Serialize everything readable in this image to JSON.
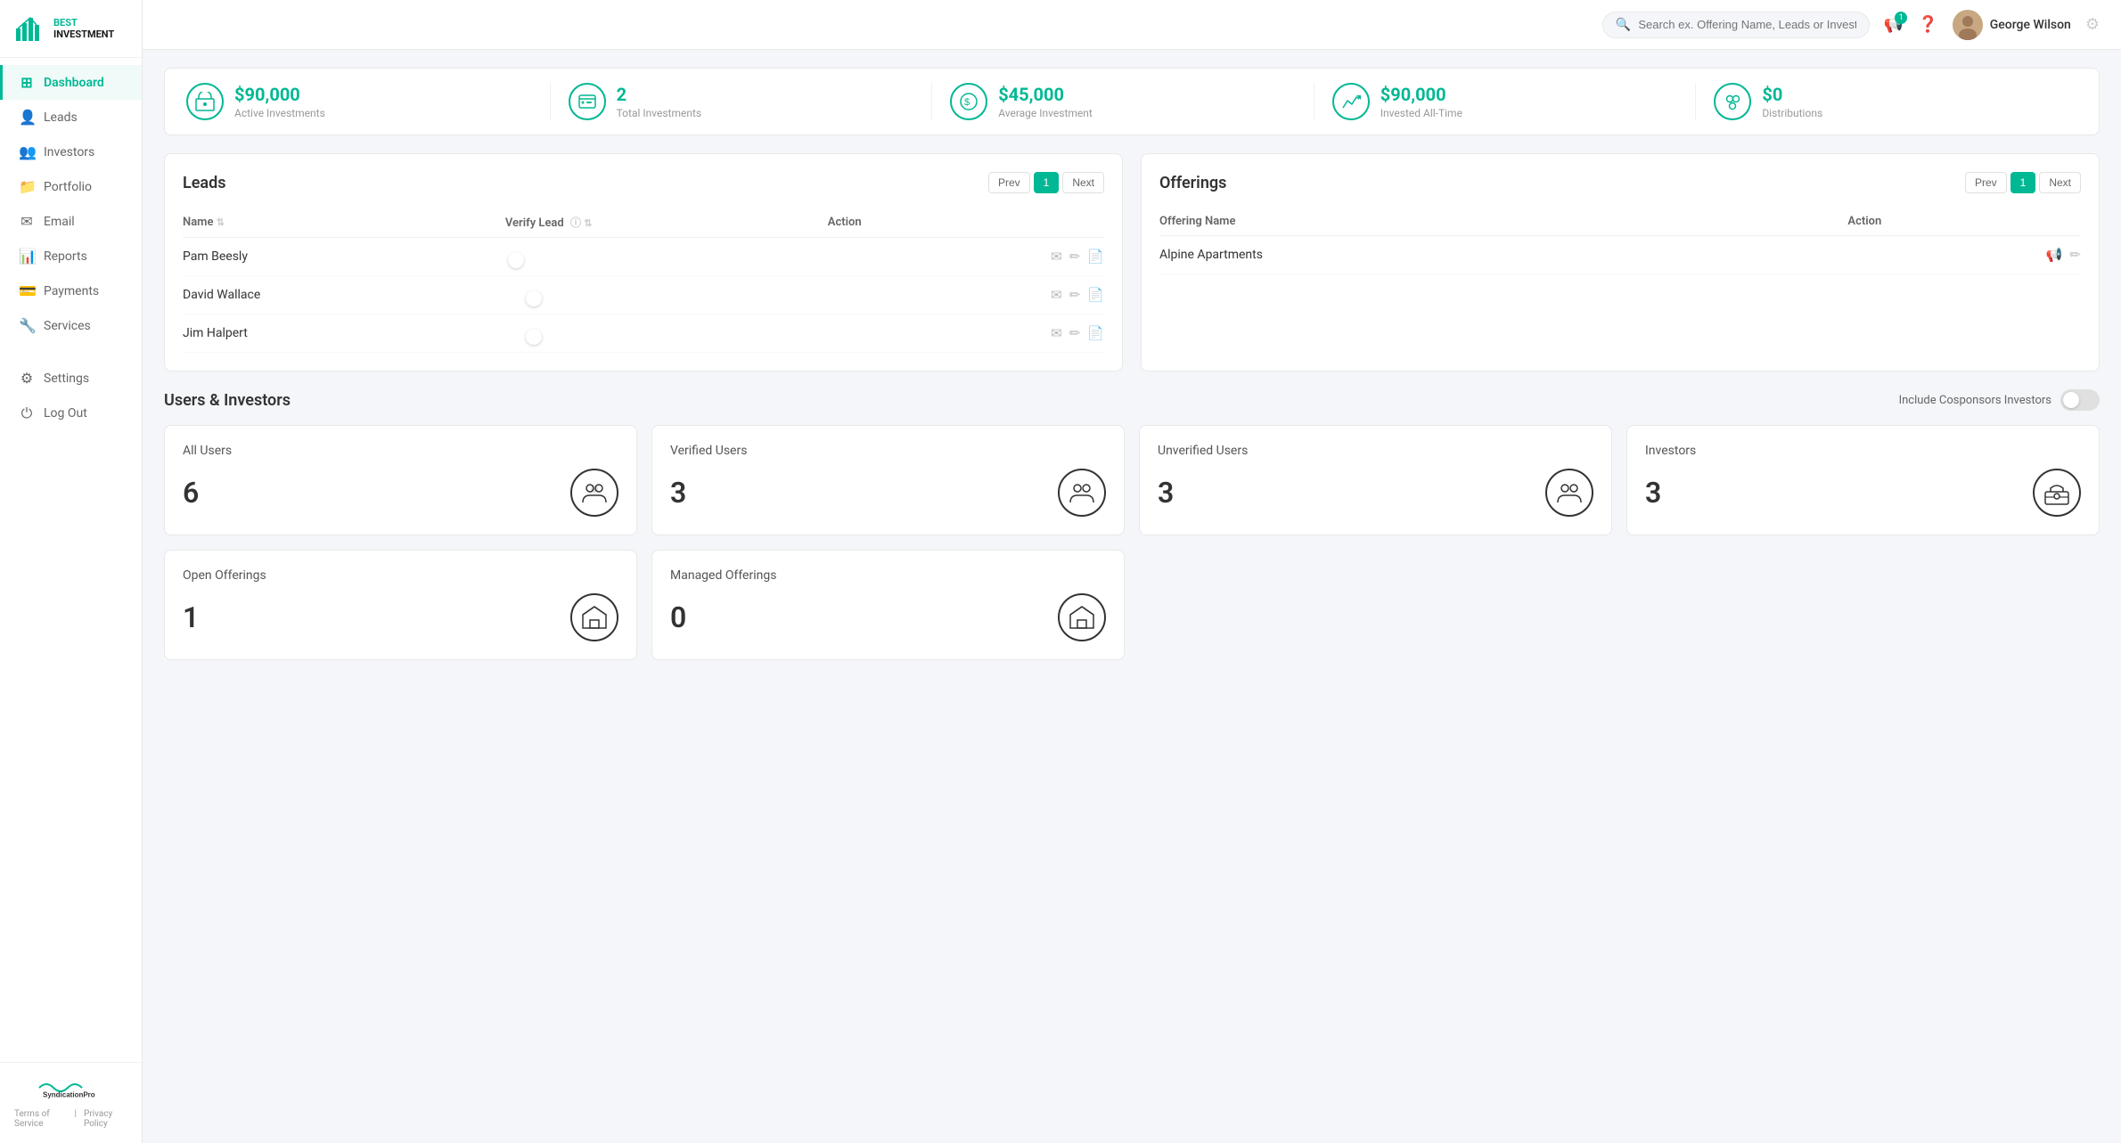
{
  "app": {
    "name": "BEST INVESTMENT",
    "subtitle": "INVESTMENT"
  },
  "topbar": {
    "search_placeholder": "Search ex. Offering Name, Leads or Investors",
    "user_name": "George Wilson",
    "notification_count": "1"
  },
  "sidebar": {
    "items": [
      {
        "id": "dashboard",
        "label": "Dashboard",
        "icon": "⊞",
        "active": true
      },
      {
        "id": "leads",
        "label": "Leads",
        "icon": "👤"
      },
      {
        "id": "investors",
        "label": "Investors",
        "icon": "👥"
      },
      {
        "id": "portfolio",
        "label": "Portfolio",
        "icon": "📁"
      },
      {
        "id": "email",
        "label": "Email",
        "icon": "✉"
      },
      {
        "id": "reports",
        "label": "Reports",
        "icon": "📊"
      },
      {
        "id": "payments",
        "label": "Payments",
        "icon": "💳"
      },
      {
        "id": "services",
        "label": "Services",
        "icon": "🔧"
      }
    ],
    "bottom_items": [
      {
        "id": "settings",
        "label": "Settings",
        "icon": "⚙"
      },
      {
        "id": "logout",
        "label": "Log Out",
        "icon": "⏻"
      }
    ],
    "footer": {
      "brand": "SyndicationPro",
      "links": [
        "Terms of Service",
        "Privacy Policy"
      ]
    }
  },
  "stats": [
    {
      "id": "active-investments",
      "value": "$90,000",
      "label": "Active Investments",
      "icon": "🏢"
    },
    {
      "id": "total-investments",
      "value": "2",
      "label": "Total Investments",
      "icon": "📋"
    },
    {
      "id": "average-investment",
      "value": "$45,000",
      "label": "Average Investment",
      "icon": "💰"
    },
    {
      "id": "invested-all-time",
      "value": "$90,000",
      "label": "Invested All-Time",
      "icon": "📈"
    },
    {
      "id": "distributions",
      "value": "$0",
      "label": "Distributions",
      "icon": "👤"
    }
  ],
  "leads_panel": {
    "title": "Leads",
    "prev_label": "Prev",
    "next_label": "Next",
    "current_page": "1",
    "columns": {
      "name": "Name",
      "verify_lead": "Verify Lead",
      "action": "Action"
    },
    "rows": [
      {
        "name": "Pam Beesly",
        "verified": false
      },
      {
        "name": "David Wallace",
        "verified": true
      },
      {
        "name": "Jim Halpert",
        "verified": true
      }
    ]
  },
  "offerings_panel": {
    "title": "Offerings",
    "prev_label": "Prev",
    "next_label": "Next",
    "current_page": "1",
    "columns": {
      "offering_name": "Offering Name",
      "action": "Action"
    },
    "rows": [
      {
        "name": "Alpine Apartments"
      }
    ]
  },
  "users_section": {
    "title": "Users & Investors",
    "include_cosponsors_label": "Include Cosponsors Investors",
    "cards": [
      {
        "id": "all-users",
        "label": "All Users",
        "value": "6",
        "icon": "👥"
      },
      {
        "id": "verified-users",
        "label": "Verified Users",
        "value": "3",
        "icon": "👥"
      },
      {
        "id": "unverified-users",
        "label": "Unverified Users",
        "value": "3",
        "icon": "👥"
      },
      {
        "id": "investors",
        "label": "Investors",
        "value": "3",
        "icon": "🏛"
      }
    ],
    "offering_cards": [
      {
        "id": "open-offerings",
        "label": "Open Offerings",
        "value": "1",
        "icon": "🏠"
      },
      {
        "id": "managed-offerings",
        "label": "Managed Offerings",
        "value": "0",
        "icon": "🏠"
      }
    ]
  }
}
